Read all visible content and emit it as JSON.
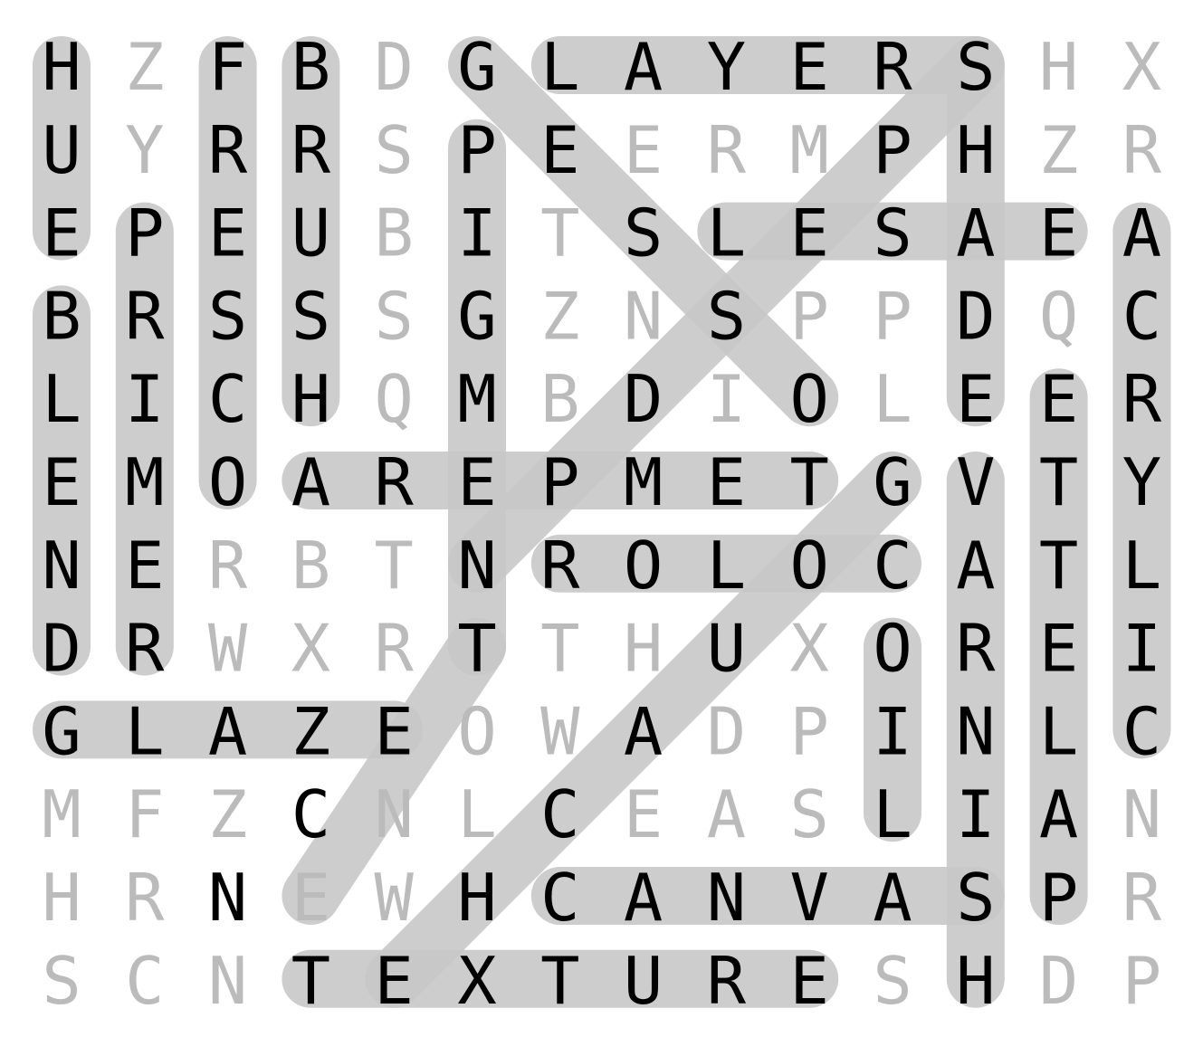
{
  "puzzle": {
    "rows": [
      "HZFBDGLAYERSHX",
      "UYRRSPERMPHZR",
      "EPEUBITSLESAEA",
      "BRSSSGZNSPPDQC",
      "LICHQMBDIOLEER",
      "EMOAREPMETGVTY",
      "NERBTNROLOCATL",
      "DRWXRTTHUXORIE",
      "GLAZEOWADPINLC",
      "MFZCNLCEASLIAN",
      "HRNEWHCANVASPR",
      "SCNTEXTURESHDP"
    ],
    "grid": [
      [
        "H",
        "Z",
        "F",
        "B",
        "D",
        "G",
        "L",
        "A",
        "Y",
        "E",
        "R",
        "S",
        "H",
        "X"
      ],
      [
        "U",
        "Y",
        "R",
        "R",
        "S",
        "P",
        "E",
        "E",
        "R",
        "M",
        "P",
        "H",
        "Z",
        "R"
      ],
      [
        "E",
        "P",
        "E",
        "U",
        "B",
        "I",
        "T",
        "S",
        "L",
        "E",
        "S",
        "A",
        "E",
        "A"
      ],
      [
        "B",
        "R",
        "S",
        "S",
        "S",
        "G",
        "Z",
        "N",
        "S",
        "P",
        "P",
        "D",
        "Q",
        "C"
      ],
      [
        "L",
        "I",
        "C",
        "H",
        "Q",
        "M",
        "B",
        "D",
        "I",
        "O",
        "L",
        "E",
        "E",
        "R"
      ],
      [
        "E",
        "M",
        "O",
        "A",
        "R",
        "E",
        "P",
        "M",
        "E",
        "T",
        "G",
        "V",
        "T",
        "Y"
      ],
      [
        "N",
        "E",
        "R",
        "B",
        "T",
        "N",
        "R",
        "O",
        "L",
        "O",
        "C",
        "A",
        "T",
        "L"
      ],
      [
        "D",
        "R",
        "W",
        "X",
        "R",
        "T",
        "T",
        "H",
        "U",
        "X",
        "O",
        "R",
        "E",
        "I"
      ],
      [
        "G",
        "L",
        "A",
        "Z",
        "E",
        "O",
        "W",
        "A",
        "D",
        "P",
        "I",
        "N",
        "L",
        "C"
      ],
      [
        "M",
        "F",
        "Z",
        "C",
        "N",
        "L",
        "C",
        "E",
        "A",
        "S",
        "L",
        "I",
        "A",
        "N"
      ],
      [
        "H",
        "R",
        "N",
        "E",
        "W",
        "H",
        "C",
        "A",
        "N",
        "V",
        "A",
        "S",
        "P",
        "R"
      ],
      [
        "S",
        "C",
        "N",
        "T",
        "E",
        "X",
        "T",
        "U",
        "R",
        "E",
        "S",
        "H",
        "D",
        "P"
      ]
    ],
    "found_words": [
      {
        "word": "HUE",
        "start": [
          0,
          0
        ],
        "end": [
          2,
          0
        ]
      },
      {
        "word": "BLEND",
        "start": [
          3,
          0
        ],
        "end": [
          7,
          0
        ]
      },
      {
        "word": "PRIMER",
        "start": [
          2,
          1
        ],
        "end": [
          7,
          1
        ]
      },
      {
        "word": "FRESCO",
        "start": [
          0,
          2
        ],
        "end": [
          5,
          2
        ]
      },
      {
        "word": "BRUSH",
        "start": [
          0,
          3
        ],
        "end": [
          4,
          3
        ]
      },
      {
        "word": "PIGMENT",
        "start": [
          1,
          5
        ],
        "end": [
          7,
          5
        ]
      },
      {
        "word": "LAYERS",
        "start": [
          0,
          6
        ],
        "end": [
          0,
          11
        ]
      },
      {
        "word": "SHADE",
        "start": [
          0,
          11
        ],
        "end": [
          4,
          11
        ]
      },
      {
        "word": "EASEL",
        "start": [
          2,
          12
        ],
        "end": [
          2,
          8
        ]
      },
      {
        "word": "ACRYLIC",
        "start": [
          2,
          13
        ],
        "end": [
          8,
          13
        ]
      },
      {
        "word": "TEMPERA",
        "start": [
          5,
          9
        ],
        "end": [
          5,
          3
        ]
      },
      {
        "word": "COLOR",
        "start": [
          6,
          10
        ],
        "end": [
          6,
          6
        ]
      },
      {
        "word": "GLAZE",
        "start": [
          8,
          0
        ],
        "end": [
          8,
          4
        ]
      },
      {
        "word": "CANVAS",
        "start": [
          10,
          6
        ],
        "end": [
          10,
          11
        ]
      },
      {
        "word": "TEXTURE",
        "start": [
          11,
          3
        ],
        "end": [
          11,
          9
        ]
      },
      {
        "word": "OIL",
        "start": [
          7,
          10
        ],
        "end": [
          9,
          10
        ]
      },
      {
        "word": "VARNISH",
        "start": [
          5,
          11
        ],
        "end": [
          11,
          11
        ]
      },
      {
        "word": "ETCHING",
        "start": [
          4,
          12
        ],
        "end": [
          10,
          12
        ]
      },
      {
        "word": "GESSO",
        "start": [
          0,
          5
        ],
        "end": [
          4,
          9
        ]
      },
      {
        "word": "TONE",
        "start": [
          7,
          5
        ],
        "end": [
          10,
          3
        ]
      },
      {
        "word": "GOUACHE",
        "start": [
          5,
          10
        ],
        "end": [
          11,
          4
        ]
      },
      {
        "word": "STENCIL",
        "start": [
          0,
          11
        ],
        "end": [
          6,
          5
        ]
      }
    ],
    "colors": {
      "background": "#ffffff",
      "highlight": "#c8c8c8",
      "found_letter": "#000000",
      "filler_letter": "#bbbbbb"
    }
  }
}
